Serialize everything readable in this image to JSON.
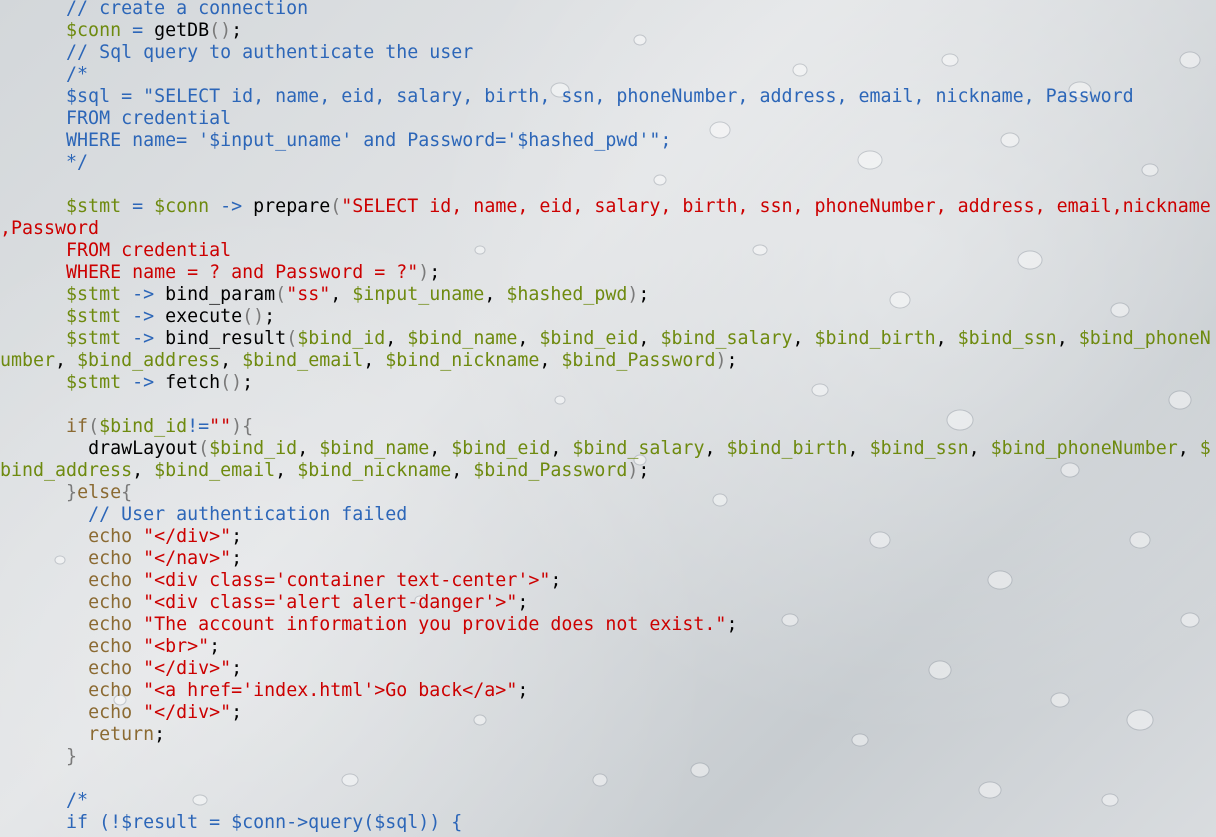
{
  "editor": {
    "colors": {
      "comment": "#2c66b8",
      "keyword": "#8b6a32",
      "variable": "#6e8a0f",
      "operator": "#2c66b8",
      "string": "#cc0000",
      "text": "#000000",
      "background": "#d9dcdf"
    },
    "lines": [
      [
        {
          "t": "      "
        },
        {
          "c": "cm",
          "t": "// create a connection"
        }
      ],
      [
        {
          "t": "      "
        },
        {
          "c": "var",
          "t": "$conn"
        },
        {
          "c": "op",
          "t": " = "
        },
        {
          "c": "fn",
          "t": "getDB"
        },
        {
          "c": "pg",
          "t": "()"
        },
        {
          "c": "pn",
          "t": ";"
        }
      ],
      [
        {
          "t": "      "
        },
        {
          "c": "cm",
          "t": "// Sql query to authenticate the user"
        }
      ],
      [
        {
          "t": "      "
        },
        {
          "c": "cm",
          "t": "/*"
        }
      ],
      [
        {
          "t": "      "
        },
        {
          "c": "cm",
          "t": "$sql = \"SELECT id, name, eid, salary, birth, ssn, phoneNumber, address, email, nickname, Password"
        }
      ],
      [
        {
          "t": "      "
        },
        {
          "c": "cm",
          "t": "FROM credential"
        }
      ],
      [
        {
          "t": "      "
        },
        {
          "c": "cm",
          "t": "WHERE name= '$input_uname' and Password='$hashed_pwd'\";"
        }
      ],
      [
        {
          "t": "      "
        },
        {
          "c": "cm",
          "t": "*/"
        }
      ],
      [
        {
          "t": ""
        }
      ],
      [
        {
          "t": "      "
        },
        {
          "c": "var",
          "t": "$stmt"
        },
        {
          "c": "op",
          "t": " = "
        },
        {
          "c": "var",
          "t": "$conn"
        },
        {
          "c": "op",
          "t": " -> "
        },
        {
          "c": "fn",
          "t": "prepare"
        },
        {
          "c": "pg",
          "t": "("
        },
        {
          "c": "str",
          "t": "\"SELECT id, name, eid, salary, birth, ssn, phoneNumber, address, email,nickname"
        }
      ],
      [
        {
          "c": "str",
          "t": ",Password"
        }
      ],
      [
        {
          "t": "      "
        },
        {
          "c": "str",
          "t": "FROM credential"
        }
      ],
      [
        {
          "t": "      "
        },
        {
          "c": "str",
          "t": "WHERE name = ? and Password = ?\""
        },
        {
          "c": "pg",
          "t": ")"
        },
        {
          "c": "pn",
          "t": ";"
        }
      ],
      [
        {
          "t": "      "
        },
        {
          "c": "var",
          "t": "$stmt"
        },
        {
          "c": "op",
          "t": " -> "
        },
        {
          "c": "fn",
          "t": "bind_param"
        },
        {
          "c": "pg",
          "t": "("
        },
        {
          "c": "str",
          "t": "\"ss\""
        },
        {
          "c": "pn",
          "t": ", "
        },
        {
          "c": "var",
          "t": "$input_uname"
        },
        {
          "c": "pn",
          "t": ", "
        },
        {
          "c": "var",
          "t": "$hashed_pwd"
        },
        {
          "c": "pg",
          "t": ")"
        },
        {
          "c": "pn",
          "t": ";"
        }
      ],
      [
        {
          "t": "      "
        },
        {
          "c": "var",
          "t": "$stmt"
        },
        {
          "c": "op",
          "t": " -> "
        },
        {
          "c": "fn",
          "t": "execute"
        },
        {
          "c": "pg",
          "t": "()"
        },
        {
          "c": "pn",
          "t": ";"
        }
      ],
      [
        {
          "t": "      "
        },
        {
          "c": "var",
          "t": "$stmt"
        },
        {
          "c": "op",
          "t": " -> "
        },
        {
          "c": "fn",
          "t": "bind_result"
        },
        {
          "c": "pg",
          "t": "("
        },
        {
          "c": "var",
          "t": "$bind_id"
        },
        {
          "c": "pn",
          "t": ", "
        },
        {
          "c": "var",
          "t": "$bind_name"
        },
        {
          "c": "pn",
          "t": ", "
        },
        {
          "c": "var",
          "t": "$bind_eid"
        },
        {
          "c": "pn",
          "t": ", "
        },
        {
          "c": "var",
          "t": "$bind_salary"
        },
        {
          "c": "pn",
          "t": ", "
        },
        {
          "c": "var",
          "t": "$bind_birth"
        },
        {
          "c": "pn",
          "t": ", "
        },
        {
          "c": "var",
          "t": "$bind_ssn"
        },
        {
          "c": "pn",
          "t": ", "
        },
        {
          "c": "var",
          "t": "$bind_phoneN"
        }
      ],
      [
        {
          "c": "var",
          "t": "umber"
        },
        {
          "c": "pn",
          "t": ", "
        },
        {
          "c": "var",
          "t": "$bind_address"
        },
        {
          "c": "pn",
          "t": ", "
        },
        {
          "c": "var",
          "t": "$bind_email"
        },
        {
          "c": "pn",
          "t": ", "
        },
        {
          "c": "var",
          "t": "$bind_nickname"
        },
        {
          "c": "pn",
          "t": ", "
        },
        {
          "c": "var",
          "t": "$bind_Password"
        },
        {
          "c": "pg",
          "t": ")"
        },
        {
          "c": "pn",
          "t": ";"
        }
      ],
      [
        {
          "t": "      "
        },
        {
          "c": "var",
          "t": "$stmt"
        },
        {
          "c": "op",
          "t": " -> "
        },
        {
          "c": "fn",
          "t": "fetch"
        },
        {
          "c": "pg",
          "t": "()"
        },
        {
          "c": "pn",
          "t": ";"
        }
      ],
      [
        {
          "t": ""
        }
      ],
      [
        {
          "t": "      "
        },
        {
          "c": "kw",
          "t": "if"
        },
        {
          "c": "pg",
          "t": "("
        },
        {
          "c": "var",
          "t": "$bind_id"
        },
        {
          "c": "op",
          "t": "!="
        },
        {
          "c": "str",
          "t": "\"\""
        },
        {
          "c": "pg",
          "t": "){"
        }
      ],
      [
        {
          "t": "        "
        },
        {
          "c": "fn",
          "t": "drawLayout"
        },
        {
          "c": "pg",
          "t": "("
        },
        {
          "c": "var",
          "t": "$bind_id"
        },
        {
          "c": "pn",
          "t": ", "
        },
        {
          "c": "var",
          "t": "$bind_name"
        },
        {
          "c": "pn",
          "t": ", "
        },
        {
          "c": "var",
          "t": "$bind_eid"
        },
        {
          "c": "pn",
          "t": ", "
        },
        {
          "c": "var",
          "t": "$bind_salary"
        },
        {
          "c": "pn",
          "t": ", "
        },
        {
          "c": "var",
          "t": "$bind_birth"
        },
        {
          "c": "pn",
          "t": ", "
        },
        {
          "c": "var",
          "t": "$bind_ssn"
        },
        {
          "c": "pn",
          "t": ", "
        },
        {
          "c": "var",
          "t": "$bind_phoneNumber"
        },
        {
          "c": "pn",
          "t": ", "
        },
        {
          "c": "var",
          "t": "$"
        }
      ],
      [
        {
          "c": "var",
          "t": "bind_address"
        },
        {
          "c": "pn",
          "t": ", "
        },
        {
          "c": "var",
          "t": "$bind_email"
        },
        {
          "c": "pn",
          "t": ", "
        },
        {
          "c": "var",
          "t": "$bind_nickname"
        },
        {
          "c": "pn",
          "t": ", "
        },
        {
          "c": "var",
          "t": "$bind_Password"
        },
        {
          "c": "pg",
          "t": ")"
        },
        {
          "c": "pn",
          "t": ";"
        }
      ],
      [
        {
          "t": "      "
        },
        {
          "c": "pg",
          "t": "}"
        },
        {
          "c": "kw",
          "t": "else"
        },
        {
          "c": "pg",
          "t": "{"
        }
      ],
      [
        {
          "t": "        "
        },
        {
          "c": "cm",
          "t": "// User authentication failed"
        }
      ],
      [
        {
          "t": "        "
        },
        {
          "c": "kw",
          "t": "echo"
        },
        {
          "c": "pn",
          "t": " "
        },
        {
          "c": "str",
          "t": "\"</div>\""
        },
        {
          "c": "pn",
          "t": ";"
        }
      ],
      [
        {
          "t": "        "
        },
        {
          "c": "kw",
          "t": "echo"
        },
        {
          "c": "pn",
          "t": " "
        },
        {
          "c": "str",
          "t": "\"</nav>\""
        },
        {
          "c": "pn",
          "t": ";"
        }
      ],
      [
        {
          "t": "        "
        },
        {
          "c": "kw",
          "t": "echo"
        },
        {
          "c": "pn",
          "t": " "
        },
        {
          "c": "str",
          "t": "\"<div class='container text-center'>\""
        },
        {
          "c": "pn",
          "t": ";"
        }
      ],
      [
        {
          "t": "        "
        },
        {
          "c": "kw",
          "t": "echo"
        },
        {
          "c": "pn",
          "t": " "
        },
        {
          "c": "str",
          "t": "\"<div class='alert alert-danger'>\""
        },
        {
          "c": "pn",
          "t": ";"
        }
      ],
      [
        {
          "t": "        "
        },
        {
          "c": "kw",
          "t": "echo"
        },
        {
          "c": "pn",
          "t": " "
        },
        {
          "c": "str",
          "t": "\"The account information you provide does not exist.\""
        },
        {
          "c": "pn",
          "t": ";"
        }
      ],
      [
        {
          "t": "        "
        },
        {
          "c": "kw",
          "t": "echo"
        },
        {
          "c": "pn",
          "t": " "
        },
        {
          "c": "str",
          "t": "\"<br>\""
        },
        {
          "c": "pn",
          "t": ";"
        }
      ],
      [
        {
          "t": "        "
        },
        {
          "c": "kw",
          "t": "echo"
        },
        {
          "c": "pn",
          "t": " "
        },
        {
          "c": "str",
          "t": "\"</div>\""
        },
        {
          "c": "pn",
          "t": ";"
        }
      ],
      [
        {
          "t": "        "
        },
        {
          "c": "kw",
          "t": "echo"
        },
        {
          "c": "pn",
          "t": " "
        },
        {
          "c": "str",
          "t": "\"<a href='index.html'>Go back</a>\""
        },
        {
          "c": "pn",
          "t": ";"
        }
      ],
      [
        {
          "t": "        "
        },
        {
          "c": "kw",
          "t": "echo"
        },
        {
          "c": "pn",
          "t": " "
        },
        {
          "c": "str",
          "t": "\"</div>\""
        },
        {
          "c": "pn",
          "t": ";"
        }
      ],
      [
        {
          "t": "        "
        },
        {
          "c": "kw",
          "t": "return"
        },
        {
          "c": "pn",
          "t": ";"
        }
      ],
      [
        {
          "t": "      "
        },
        {
          "c": "pg",
          "t": "}"
        }
      ],
      [
        {
          "t": ""
        }
      ],
      [
        {
          "t": "      "
        },
        {
          "c": "cm",
          "t": "/*"
        }
      ],
      [
        {
          "t": "      "
        },
        {
          "c": "cm",
          "t": "if (!$result = $conn->query($sql)) {"
        }
      ]
    ]
  }
}
